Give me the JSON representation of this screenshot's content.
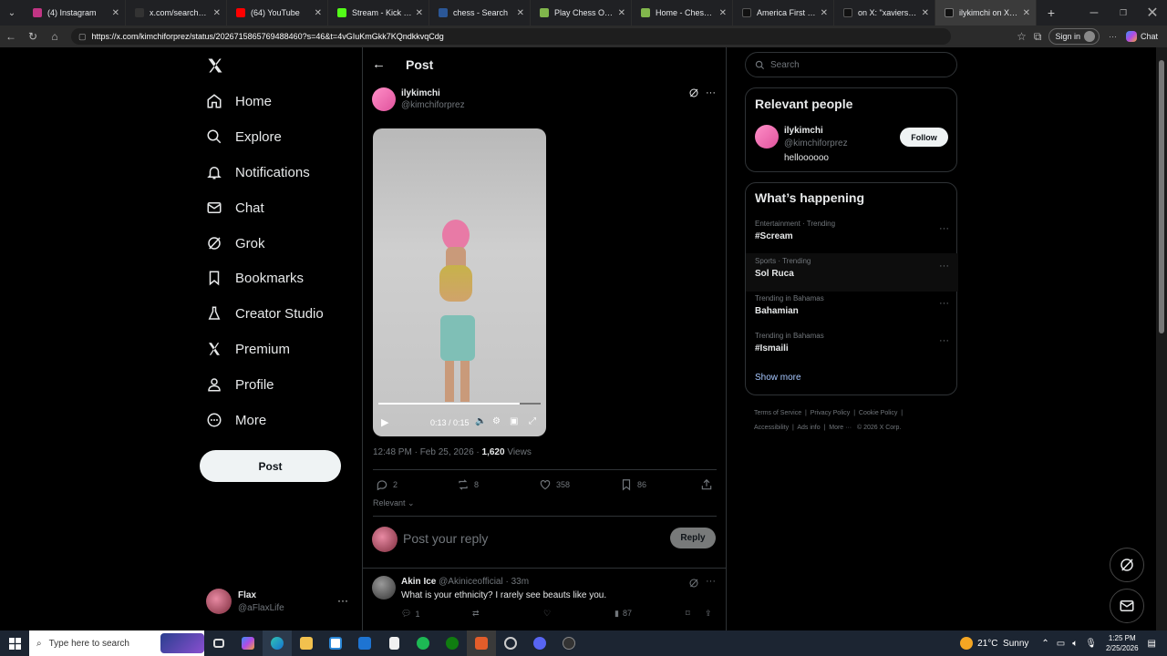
{
  "browser": {
    "tabs": [
      {
        "title": "(4) Instagram",
        "color": "#c13584"
      },
      {
        "title": "x.com/search?q=vj e",
        "color": "#333333"
      },
      {
        "title": "(64) YouTube",
        "color": "#ff0000"
      },
      {
        "title": "Stream - Kick Dashb",
        "color": "#53fc18"
      },
      {
        "title": "chess - Search",
        "color": "#2b5797"
      },
      {
        "title": "Play Chess Online fo",
        "color": "#81b64c"
      },
      {
        "title": "Home - Chess.com",
        "color": "#81b64c"
      },
      {
        "title": "America First vs Isra",
        "color": "#111111"
      },
      {
        "title": "on X: \"xaviersoba",
        "color": "#111111"
      },
      {
        "title": "ilykimchi on X: \"http",
        "color": "#111111"
      }
    ],
    "url": "https://x.com/kimchiforprez/status/2026715865769488460?s=46&t=4vGIuKmGkk7KQndkkvqCdg",
    "sign_in": "Sign in",
    "chat": "Chat"
  },
  "nav": {
    "items": [
      {
        "label": "Home",
        "icon": "home-icon"
      },
      {
        "label": "Explore",
        "icon": "search-icon"
      },
      {
        "label": "Notifications",
        "icon": "bell-icon"
      },
      {
        "label": "Chat",
        "icon": "mail-icon"
      },
      {
        "label": "Grok",
        "icon": "grok-icon"
      },
      {
        "label": "Bookmarks",
        "icon": "bookmark-icon"
      },
      {
        "label": "Creator Studio",
        "icon": "flask-icon"
      },
      {
        "label": "Premium",
        "icon": "x-icon"
      },
      {
        "label": "Profile",
        "icon": "person-icon"
      },
      {
        "label": "More",
        "icon": "more-circle-icon"
      }
    ],
    "post_button": "Post",
    "account": {
      "name": "Flax",
      "handle": "@aFlaxLife"
    }
  },
  "post": {
    "header": "Post",
    "author": {
      "name": "ilykimchi",
      "handle": "@kimchiforprez"
    },
    "video": {
      "time": "0:13 / 0:15",
      "progress": 0.87
    },
    "timestamp": "12:48 PM · Feb 25, 2026 · ",
    "views_count": "1,620",
    "views_label": " Views",
    "stats": {
      "replies": "2",
      "reposts": "8",
      "likes": "358",
      "bookmarks": "86"
    },
    "sort": "Relevant",
    "reply_placeholder": "Post your reply",
    "reply_button": "Reply"
  },
  "reply": {
    "author": "Akin Ice",
    "handle": "@Akiniceofficial",
    "time": " · 33m",
    "text": "What is your ethnicity? I rarely see beauts like you.",
    "replies": "1",
    "views": "87"
  },
  "sidebar": {
    "search_placeholder": "Search",
    "relevant_title": "Relevant people",
    "person": {
      "name": "ilykimchi",
      "handle": "@kimchiforprez",
      "bio": "helloooooo",
      "follow": "Follow"
    },
    "happening_title": "What’s happening",
    "trends": [
      {
        "category": "Entertainment · Trending",
        "name": "#Scream"
      },
      {
        "category": "Sports · Trending",
        "name": "Sol Ruca"
      },
      {
        "category": "Trending in Bahamas",
        "name": "Bahamian"
      },
      {
        "category": "Trending in Bahamas",
        "name": "#Ismaili"
      }
    ],
    "show_more": "Show more",
    "footer": [
      "Terms of Service",
      "Privacy Policy",
      "Cookie Policy",
      "Accessibility",
      "Ads info",
      "More ···",
      "© 2026 X Corp."
    ]
  },
  "taskbar": {
    "search_placeholder": "Type here to search",
    "weather": "21°C  Sunny",
    "time": "1:25 PM",
    "date": "2/25/2026"
  },
  "colors": {
    "accent": "#1d9bf0",
    "link": "#a7c7ff",
    "bg": "#000000",
    "border": "#2f3336"
  }
}
